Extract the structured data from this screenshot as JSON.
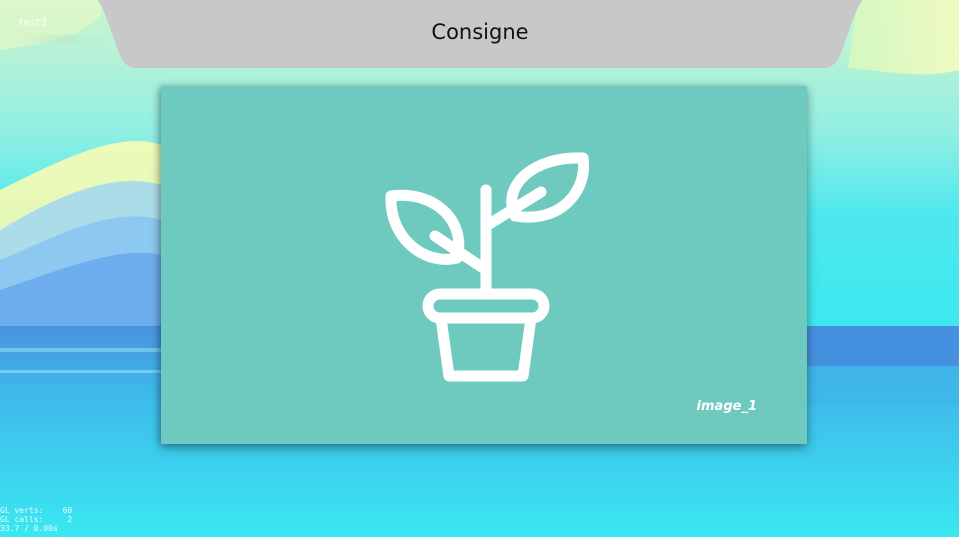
{
  "app": {
    "corner_label": "test3",
    "header_title": "Consigne"
  },
  "card": {
    "icon": "potted-plant-icon",
    "caption": "image_1",
    "background": "#6ecabf"
  },
  "debug": {
    "lines": [
      "GL verts:    60",
      "GL calls:     2",
      "33.7 / 0.00s"
    ]
  },
  "colors": {
    "header": "#c8c8c8",
    "sky_top": "#c8f7d0",
    "sea": "#3de8f0"
  }
}
